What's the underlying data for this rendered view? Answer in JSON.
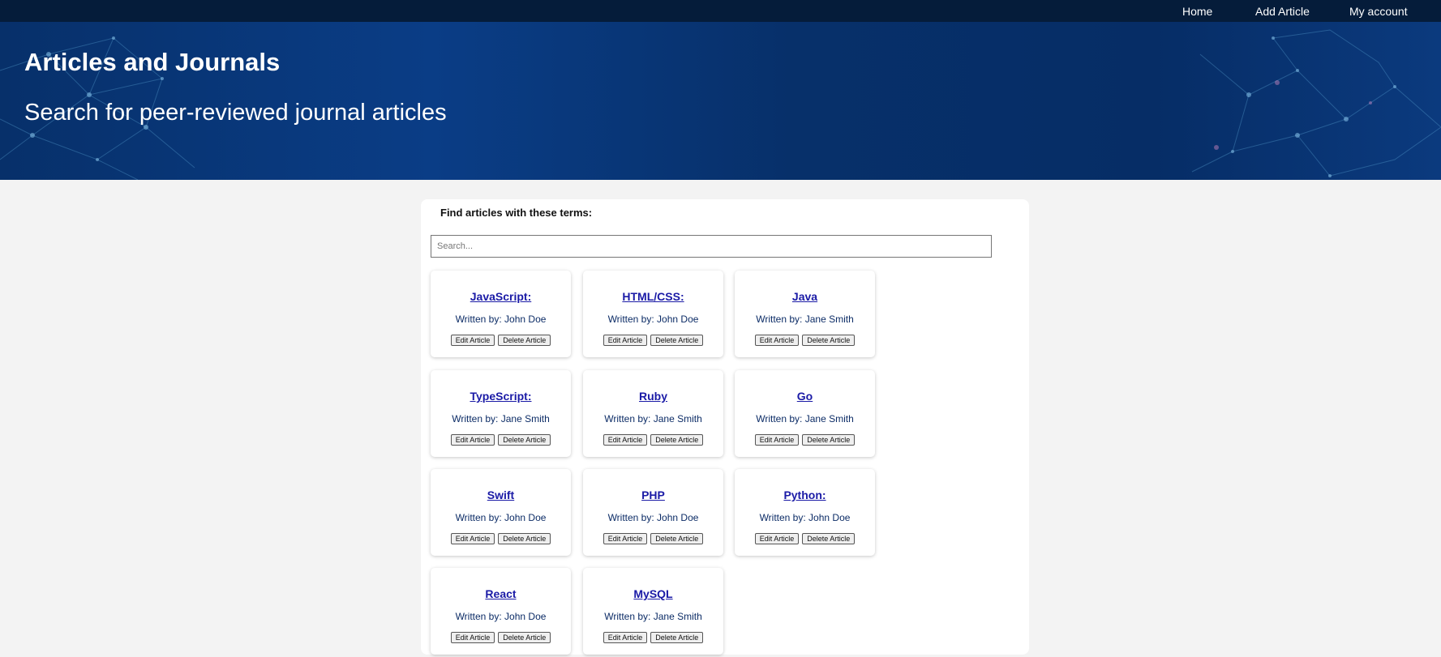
{
  "nav": {
    "home": "Home",
    "add_article": "Add Article",
    "my_account": "My account"
  },
  "hero": {
    "title": "Articles and Journals",
    "subtitle": "Search for peer-reviewed journal articles"
  },
  "search": {
    "label": "Find articles with these terms:",
    "placeholder": "Search...",
    "value": ""
  },
  "card_labels": {
    "author_prefix": "Written by:",
    "edit": "Edit Article",
    "delete": "Delete Article"
  },
  "articles": [
    {
      "title": "JavaScript:",
      "author": "John Doe"
    },
    {
      "title": "HTML/CSS:",
      "author": "John Doe"
    },
    {
      "title": "Java",
      "author": "Jane Smith"
    },
    {
      "title": "TypeScript:",
      "author": "Jane Smith"
    },
    {
      "title": "Ruby",
      "author": "Jane Smith"
    },
    {
      "title": "Go",
      "author": "Jane Smith"
    },
    {
      "title": "Swift",
      "author": "John Doe"
    },
    {
      "title": "PHP",
      "author": "John Doe"
    },
    {
      "title": "Python:",
      "author": "John Doe"
    },
    {
      "title": "React",
      "author": "John Doe"
    },
    {
      "title": "MySQL",
      "author": "Jane Smith"
    }
  ],
  "colors": {
    "nav_bg": "#051c3a",
    "hero_bg": "#07306a",
    "link": "#1a1aa6",
    "author": "#0c2c66"
  }
}
